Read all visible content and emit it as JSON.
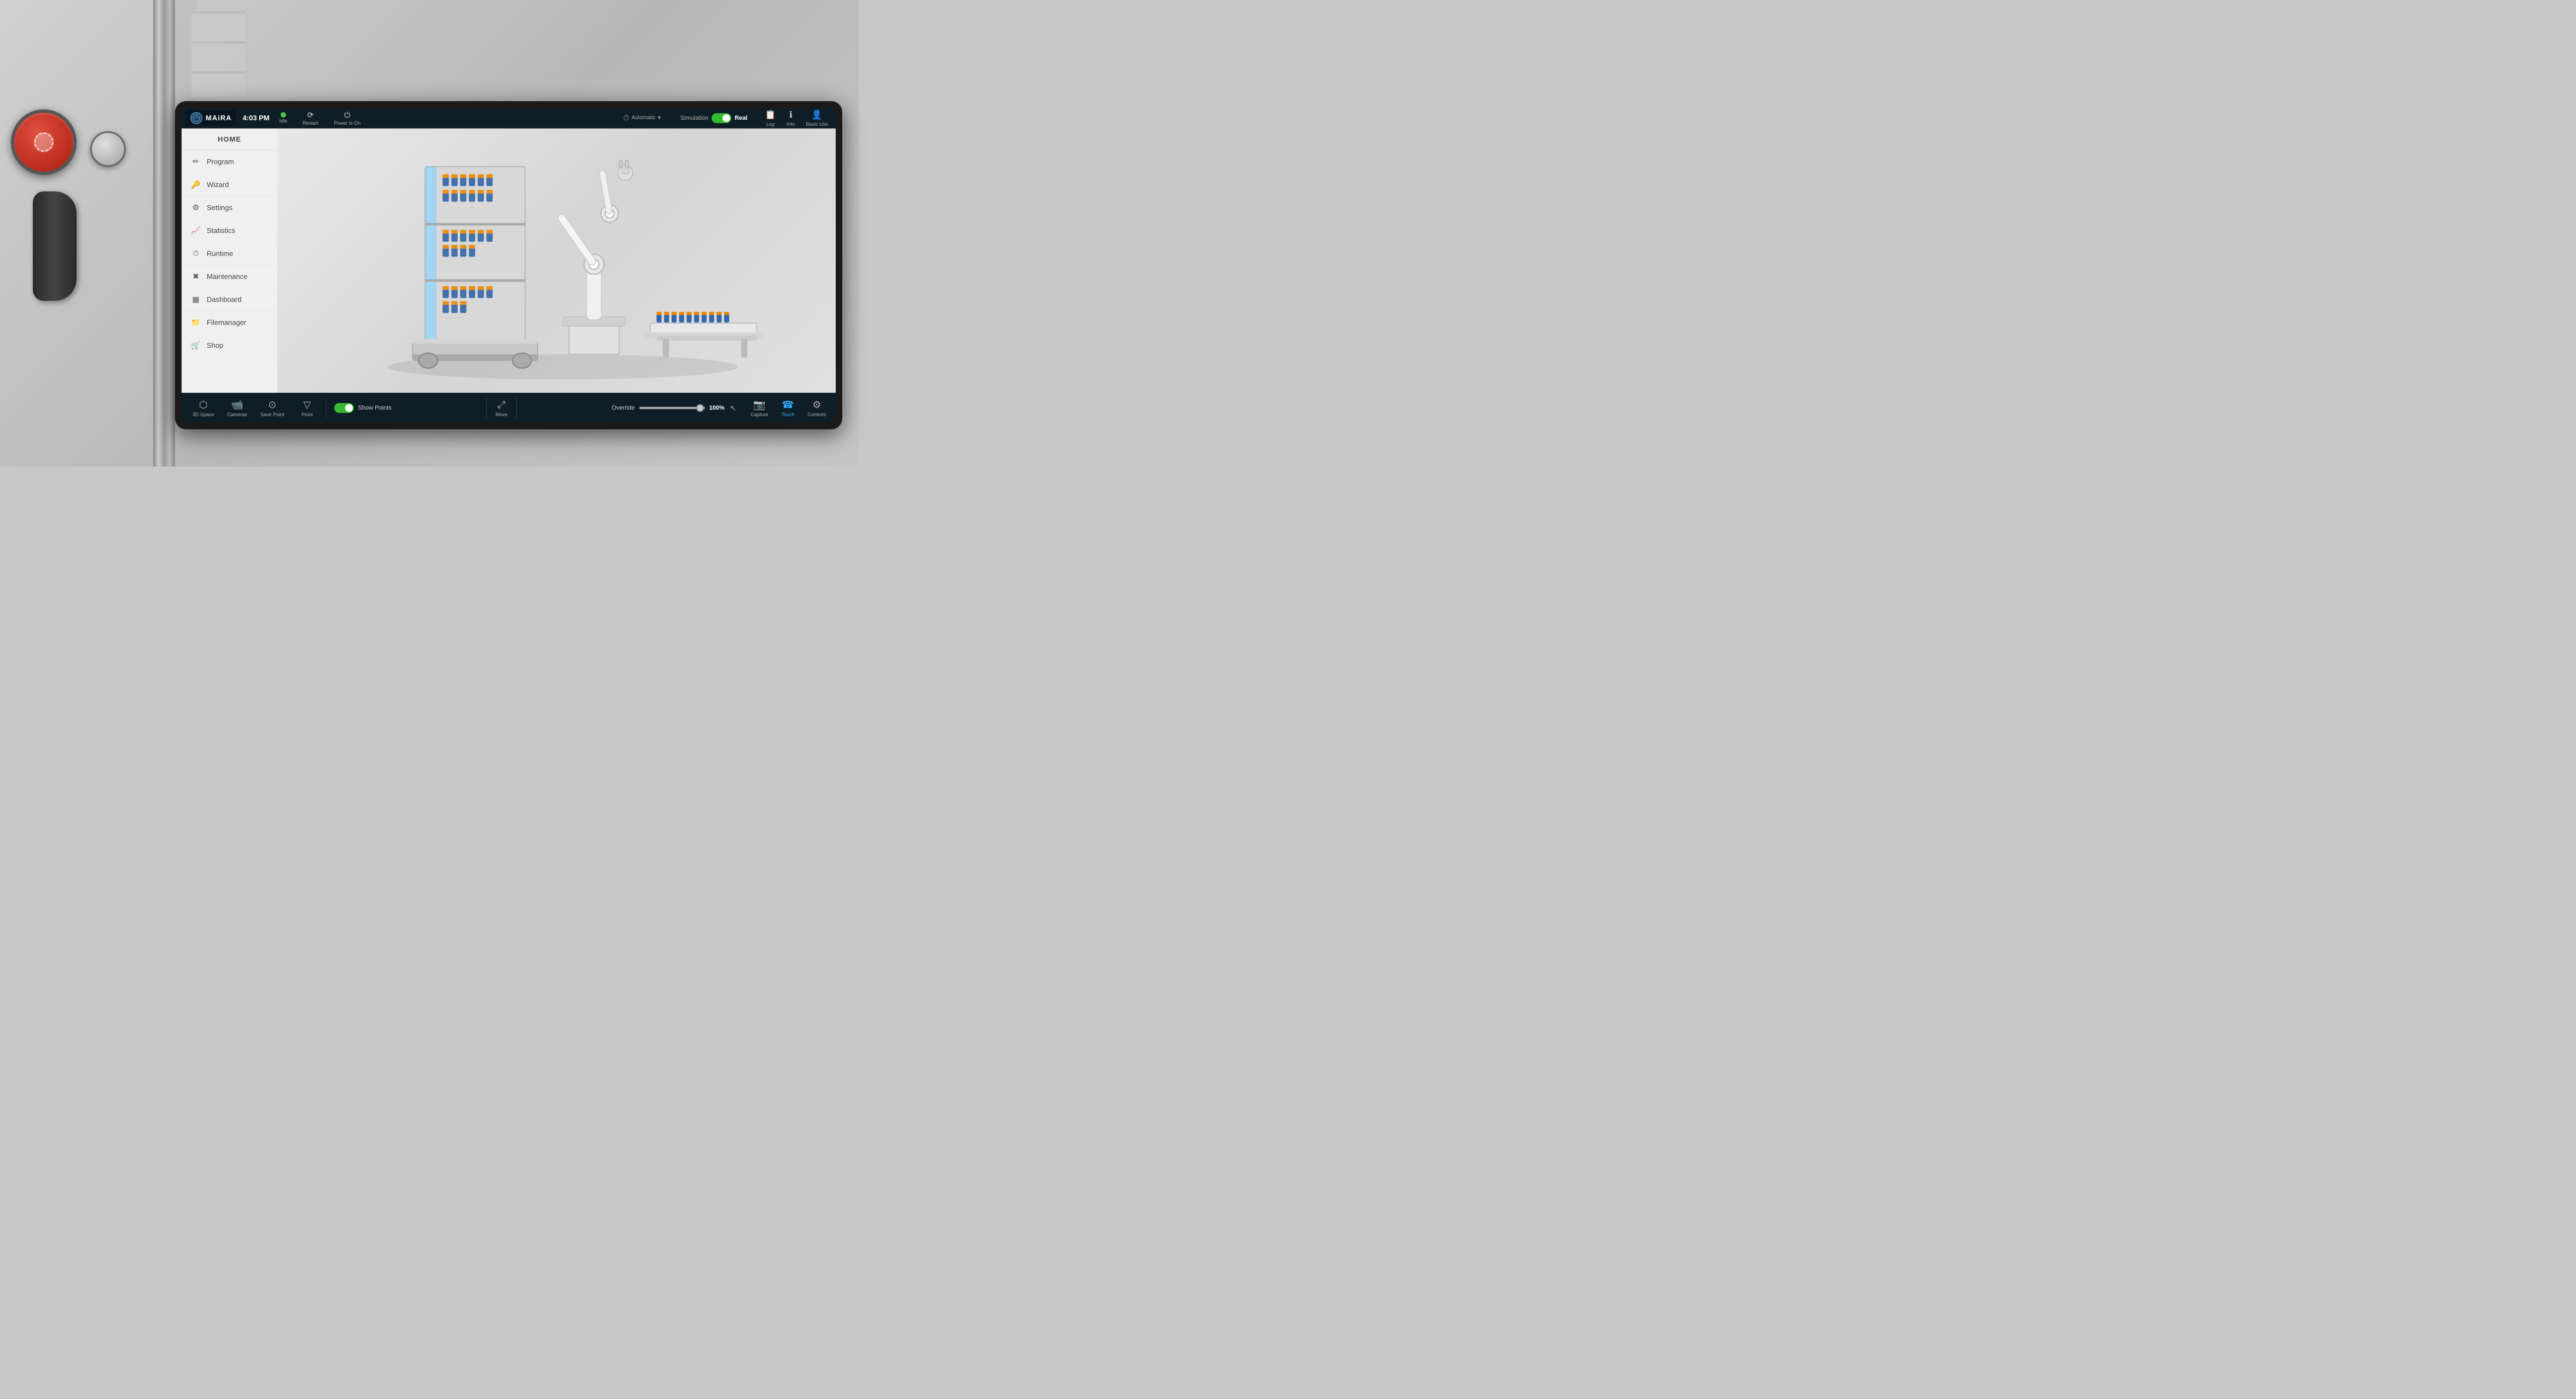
{
  "app": {
    "name": "MAiRA",
    "time": "4:03 PM"
  },
  "header": {
    "status": {
      "idle_dot_color": "#44cc44",
      "idle_label": "Idle",
      "restart_label": "Restart",
      "power_label": "Power is On"
    },
    "mode": {
      "icon": "⚙",
      "label": "Automatic",
      "chevron": "▾"
    },
    "simulation": {
      "sim_label": "Simulation",
      "real_label": "Real",
      "toggle_on": true
    },
    "buttons": {
      "log_label": "Log",
      "info_label": "Info",
      "user_label": "Basic Use"
    }
  },
  "sidebar": {
    "home_label": "HOME",
    "items": [
      {
        "label": "Program",
        "icon": "✏"
      },
      {
        "label": "Wizard",
        "icon": "🔧"
      },
      {
        "label": "Settings",
        "icon": "⚙"
      },
      {
        "label": "Statistics",
        "icon": "📊"
      },
      {
        "label": "Runtime",
        "icon": "⏱"
      },
      {
        "label": "Maintenance",
        "icon": "🔨"
      },
      {
        "label": "Dashboard",
        "icon": "▦"
      },
      {
        "label": "Filemanager",
        "icon": "📁"
      },
      {
        "label": "Shop",
        "icon": "🛒"
      }
    ]
  },
  "bottom_toolbar": {
    "buttons": [
      {
        "label": "3D Space",
        "icon": "⬡"
      },
      {
        "label": "Cameras",
        "icon": "🎥"
      },
      {
        "label": "Save Point",
        "icon": "⊙"
      },
      {
        "label": "Point",
        "icon": "▽"
      }
    ],
    "show_points": {
      "label": "Show Points",
      "enabled": true
    },
    "move": {
      "label": "Move",
      "icon": "⤢"
    },
    "override": {
      "label": "Override",
      "value": "100%"
    },
    "right_buttons": [
      {
        "label": "Capture",
        "icon": "📷"
      },
      {
        "label": "Touch",
        "icon": "☎",
        "active": true
      },
      {
        "label": "Controls",
        "icon": "⚙"
      }
    ]
  }
}
